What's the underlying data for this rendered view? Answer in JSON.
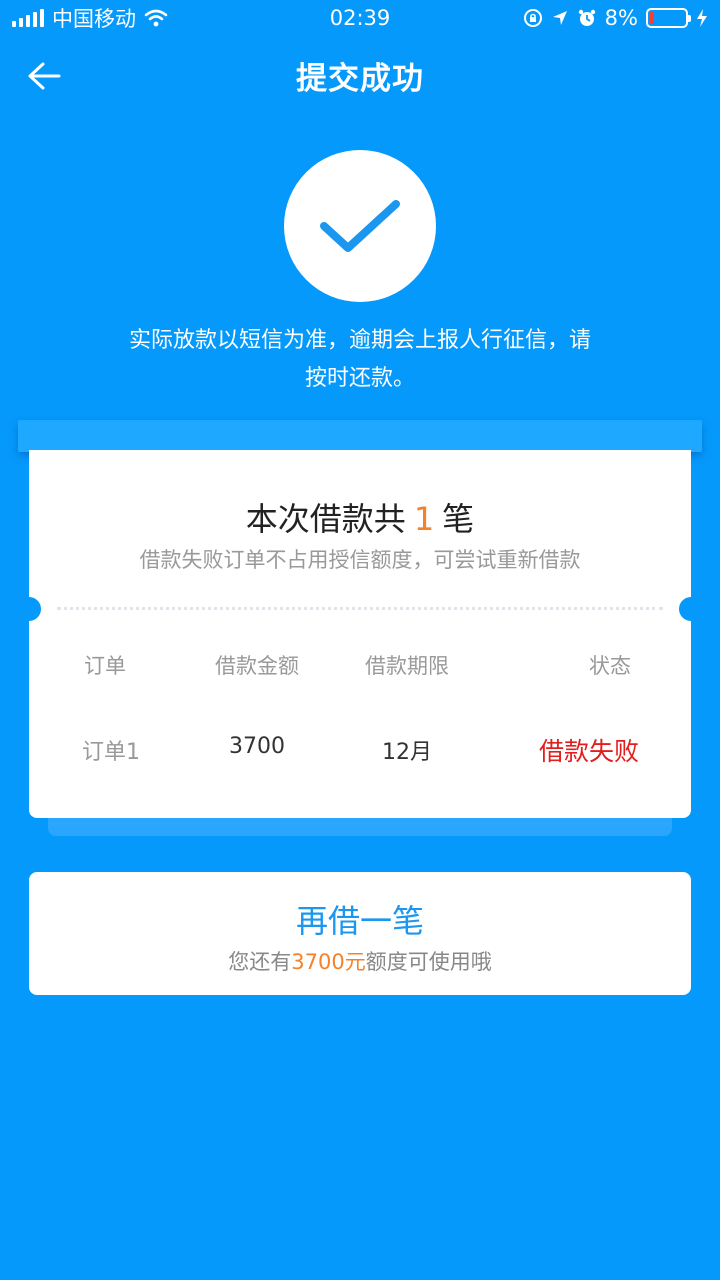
{
  "status_bar": {
    "carrier": "中国移动",
    "time": "02:39",
    "battery": "8%"
  },
  "header": {
    "title": "提交成功"
  },
  "success": {
    "notice_line1": "实际放款以短信为准，逾期会上报人行征信，请",
    "notice_line2": "按时还款。"
  },
  "ticket": {
    "title_prefix": "本次借款共",
    "count": "1",
    "title_suffix": "笔",
    "subtitle": "借款失败订单不占用授信额度，可尝试重新借款",
    "columns": [
      "订单",
      "借款金额",
      "借款期限",
      "状态"
    ],
    "rows": [
      {
        "order": "订单1",
        "amount": "3700",
        "term": "12月",
        "status": "借款失败"
      }
    ]
  },
  "reborrow": {
    "title": "再借一笔",
    "sub_prefix": "您还有",
    "sub_amount": "3700元",
    "sub_suffix": "额度可使用哦"
  },
  "colors": {
    "background": "#0599fb",
    "accent_orange": "#f5822a",
    "status_fail": "#e21e1e",
    "link_blue": "#1b97f0"
  }
}
